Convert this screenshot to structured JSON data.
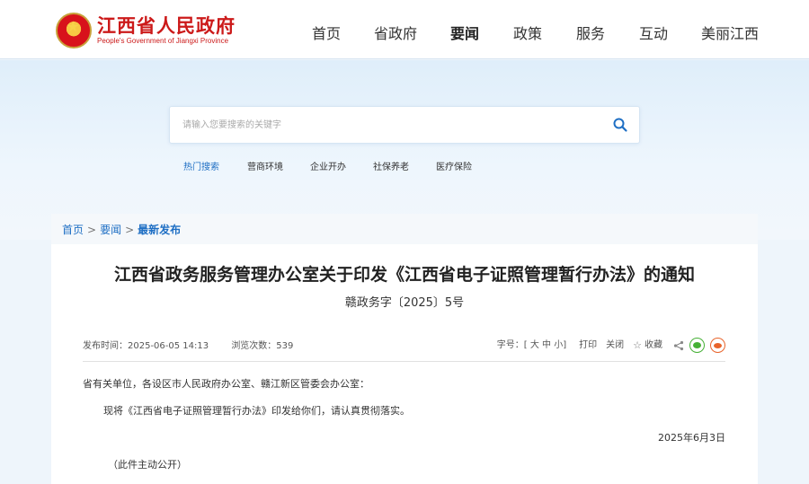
{
  "header": {
    "logo_cn": "江西省人民政府",
    "logo_en": "People's Government of Jiangxi Province",
    "nav": [
      "首页",
      "省政府",
      "要闻",
      "政策",
      "服务",
      "互动",
      "美丽江西"
    ]
  },
  "search": {
    "placeholder": "请输入您要搜索的关键字",
    "hot_links": [
      "热门搜索",
      "营商环境",
      "企业开办",
      "社保养老",
      "医疗保险"
    ]
  },
  "breadcrumb": [
    "首页",
    "要闻",
    "最新发布"
  ],
  "article": {
    "title": "江西省政务服务管理办公室关于印发《江西省电子证照管理暂行办法》的通知",
    "doc_number": "赣政务字〔2025〕5号",
    "publish_time": "发布时间：2025-06-05 14:13",
    "views": "浏览次数：539",
    "font_size_label": "字号：",
    "font_size_open": "[",
    "font_sizes": [
      "大",
      "中",
      "小"
    ],
    "font_size_close": "]",
    "print_label": "打印",
    "close_label": "关闭",
    "favorite_label": "收藏",
    "salutation": "省有关单位，各设区市人民政府办公室、赣江新区管委会办公室：",
    "paragraph": "现将《江西省电子证照管理暂行办法》印发给你们，请认真贯彻落实。",
    "date": "2025年6月3日",
    "note": "（此件主动公开）"
  },
  "colors": {
    "accent": "#1f6fc4",
    "brand_red": "#cc1a1a",
    "wechat": "#45b035",
    "weibo": "#e8632a"
  }
}
